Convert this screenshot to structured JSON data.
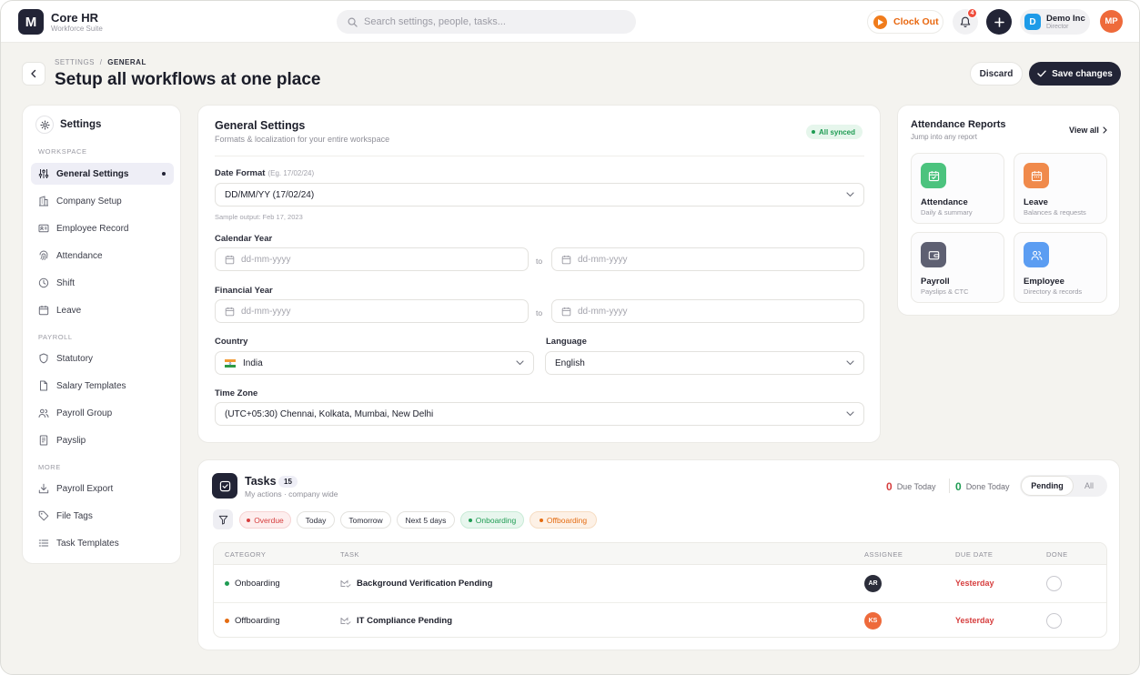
{
  "app": {
    "logo_letter": "M",
    "name": "Core HR",
    "subtitle": "Workforce Suite"
  },
  "topbar": {
    "search_placeholder": "Search settings, people, tasks...",
    "clock_out_label": "Clock Out",
    "notifications_count": "4",
    "org": {
      "logo_letter": "D",
      "name": "Demo Inc",
      "role": "Director"
    },
    "user_initials": "MP"
  },
  "header": {
    "breadcrumb": {
      "parent": "SETTINGS",
      "separator": "/",
      "current": "GENERAL"
    },
    "title": "Setup all workflows at one place",
    "discard_label": "Discard",
    "save_label": "Save changes"
  },
  "sidebar": {
    "title": "Settings",
    "sections": {
      "workspace": "WORKSPACE",
      "payroll": "PAYROLL",
      "more": "MORE"
    },
    "items": [
      {
        "label": "General Settings",
        "icon": "sliders-icon",
        "active": true
      },
      {
        "label": "Company Setup",
        "icon": "building-icon"
      },
      {
        "label": "Employee Record",
        "icon": "id-card-icon"
      },
      {
        "label": "Attendance",
        "icon": "fingerprint-icon"
      },
      {
        "label": "Shift",
        "icon": "clock-icon"
      },
      {
        "label": "Leave",
        "icon": "calendar-icon"
      },
      {
        "label": "Statutory",
        "icon": "shield-icon"
      },
      {
        "label": "Salary Templates",
        "icon": "document-icon"
      },
      {
        "label": "Payroll Group",
        "icon": "users-icon"
      },
      {
        "label": "Payslip",
        "icon": "receipt-icon"
      },
      {
        "label": "Payroll Export",
        "icon": "download-icon"
      },
      {
        "label": "File Tags",
        "icon": "tag-icon"
      },
      {
        "label": "Task Templates",
        "icon": "list-icon"
      }
    ]
  },
  "general": {
    "title": "General Settings",
    "subtitle": "Formats & localization for your entire workspace",
    "sync_badge": "All synced",
    "date_format": {
      "label": "Date Format",
      "hint": "(Eg. 17/02/24)",
      "value": "DD/MM/YY (17/02/24)",
      "sample": "Sample output: Feb 17, 2023"
    },
    "calendar_year": {
      "label": "Calendar Year",
      "from_placeholder": "dd-mm-yyyy",
      "to_label": "to",
      "to_placeholder": "dd-mm-yyyy"
    },
    "financial_year": {
      "label": "Financial Year",
      "from_placeholder": "dd-mm-yyyy",
      "to_label": "to",
      "to_placeholder": "dd-mm-yyyy"
    },
    "country": {
      "label": "Country",
      "value": "India",
      "flag": "india-flag-icon"
    },
    "language": {
      "label": "Language",
      "value": "English"
    },
    "timezone": {
      "label": "Time Zone",
      "value": "(UTC+05:30) Chennai, Kolkata, Mumbai, New Delhi"
    }
  },
  "reports": {
    "title": "Attendance Reports",
    "subtitle": "Jump into any report",
    "view_all": "View all",
    "tiles": [
      {
        "name": "Attendance",
        "desc": "Daily & summary",
        "icon": "calendar-check-icon",
        "color": "#4cc37e"
      },
      {
        "name": "Leave",
        "desc": "Balances & requests",
        "icon": "calendar-icon",
        "color": "#f08a4b"
      },
      {
        "name": "Payroll",
        "desc": "Payslips & CTC",
        "icon": "wallet-icon",
        "color": "#5e6072"
      },
      {
        "name": "Employee",
        "desc": "Directory & records",
        "icon": "users-icon",
        "color": "#5b9df2"
      }
    ]
  },
  "tasks": {
    "title": "Tasks",
    "count": "15",
    "subtitle": "My actions · company wide",
    "due_today": {
      "value": "0",
      "label": "Due Today"
    },
    "done_today": {
      "value": "0",
      "label": "Done Today"
    },
    "segment": {
      "selected": "Pending",
      "other": "All"
    },
    "filters": [
      "Overdue",
      "Today",
      "Tomorrow",
      "Next 5 days",
      "Onboarding",
      "Offboarding"
    ],
    "columns": [
      "CATEGORY",
      "TASK",
      "ASSIGNEE",
      "DUE DATE",
      "DONE"
    ],
    "rows": [
      {
        "category": "Onboarding",
        "category_color": "#1f9c53",
        "task": "Background Verification Pending",
        "assignee": "AR",
        "assignee_color": "#2b2d3a",
        "due": "Yesterday"
      },
      {
        "category": "Offboarding",
        "category_color": "#e46c12",
        "task": "IT Compliance Pending",
        "assignee": "KS",
        "assignee_color": "#ee6a3b",
        "due": "Yesterday"
      }
    ]
  },
  "colors": {
    "primary": "#222436",
    "accent_orange": "#f07c1c",
    "danger": "#d63e3e",
    "success": "#1f9c53"
  }
}
